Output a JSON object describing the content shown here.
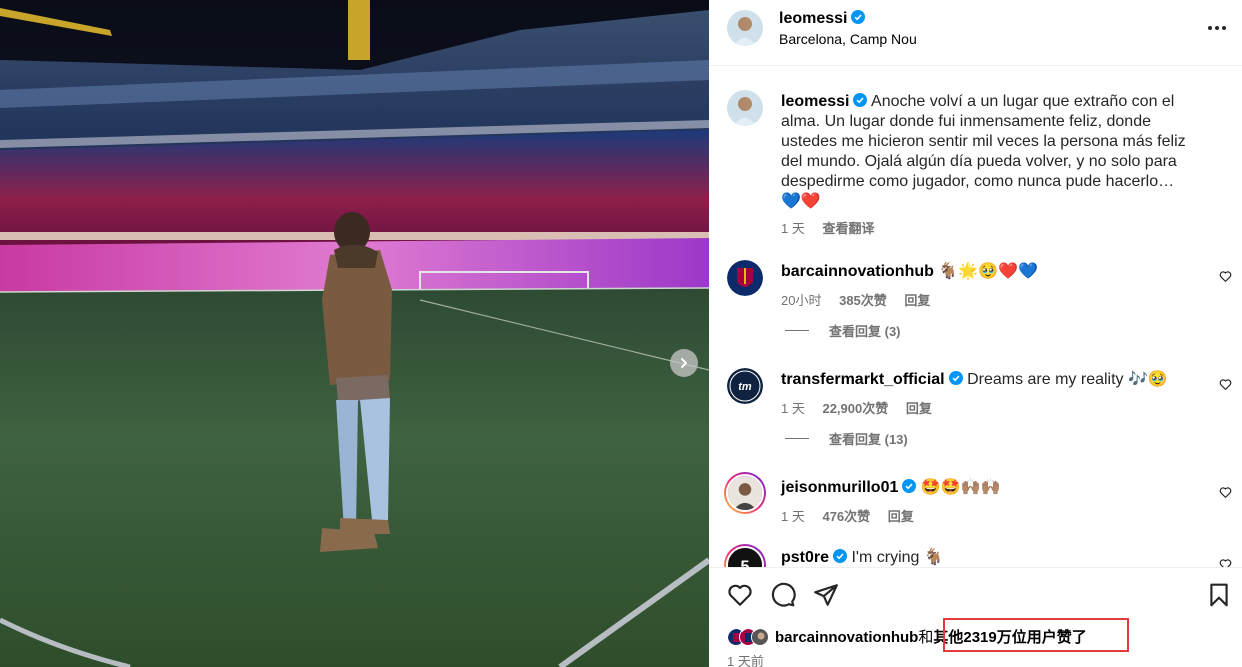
{
  "post": {
    "username": "leomessi",
    "location": "Barcelona, Camp Nou"
  },
  "caption": {
    "username": "leomessi",
    "text": "Anoche volví a un lugar que extraño con el alma. Un lugar donde fui inmensamente feliz, donde ustedes me hicieron sentir mil veces la persona más feliz del mundo. Ojalá algún día pueda volver, y no solo para despedirme como jugador, como nunca pude hacerlo…",
    "emoji": "💙❤️",
    "time": "1 天",
    "translate": "查看翻译"
  },
  "comments": [
    {
      "username": "barcainnovationhub",
      "text": "🐐🌟🥹❤️💙",
      "time": "20小时",
      "likes": "385次赞",
      "reply": "回复",
      "view_replies": "查看回复 (3)",
      "verified": false
    },
    {
      "username": "transfermarkt_official",
      "text": "Dreams are my reality 🎶🥹",
      "time": "1 天",
      "likes": "22,900次赞",
      "reply": "回复",
      "view_replies": "查看回复 (13)",
      "verified": true
    },
    {
      "username": "jeisonmurillo01",
      "text": "🤩🤩🙌🏽🙌🏽",
      "time": "1 天",
      "likes": "476次赞",
      "reply": "回复",
      "verified": true
    },
    {
      "username": "pst0re",
      "text": "I'm crying 🐐",
      "verified": true
    }
  ],
  "likes_bar": {
    "first_liker": "barcainnovationhub",
    "joiner": "和",
    "others": "其他2319万位用户赞了",
    "posted_ago": "1 天前"
  },
  "icons": [
    "more-icon",
    "verified-icon",
    "heart-icon",
    "comment-icon",
    "share-icon",
    "bookmark-icon",
    "chevron-right-icon"
  ],
  "colors": {
    "verified": "#0095f6",
    "highlight_box": "#e23b3b",
    "muted": "#737373"
  }
}
